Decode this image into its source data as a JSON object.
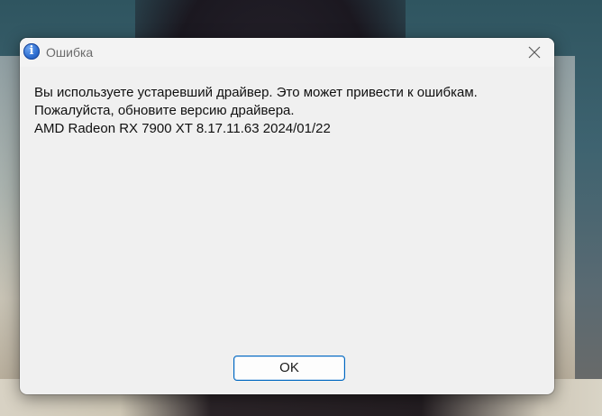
{
  "dialog": {
    "title": "Ошибка",
    "icon": "info-icon",
    "icon_glyph": "i",
    "message_lines": [
      "Вы используете устаревший драйвер. Это может привести к ошибкам.",
      "Пожалуйста, обновите версию драйвера.",
      "AMD Radeon RX 7900 XT 8.17.11.63 2024/01/22"
    ],
    "ok_label": "OK",
    "close_icon": "close-icon"
  },
  "colors": {
    "dialog_background": "#f0f0f0",
    "button_border_accent": "#0067c0",
    "info_icon_blue": "#2f6fd1"
  }
}
